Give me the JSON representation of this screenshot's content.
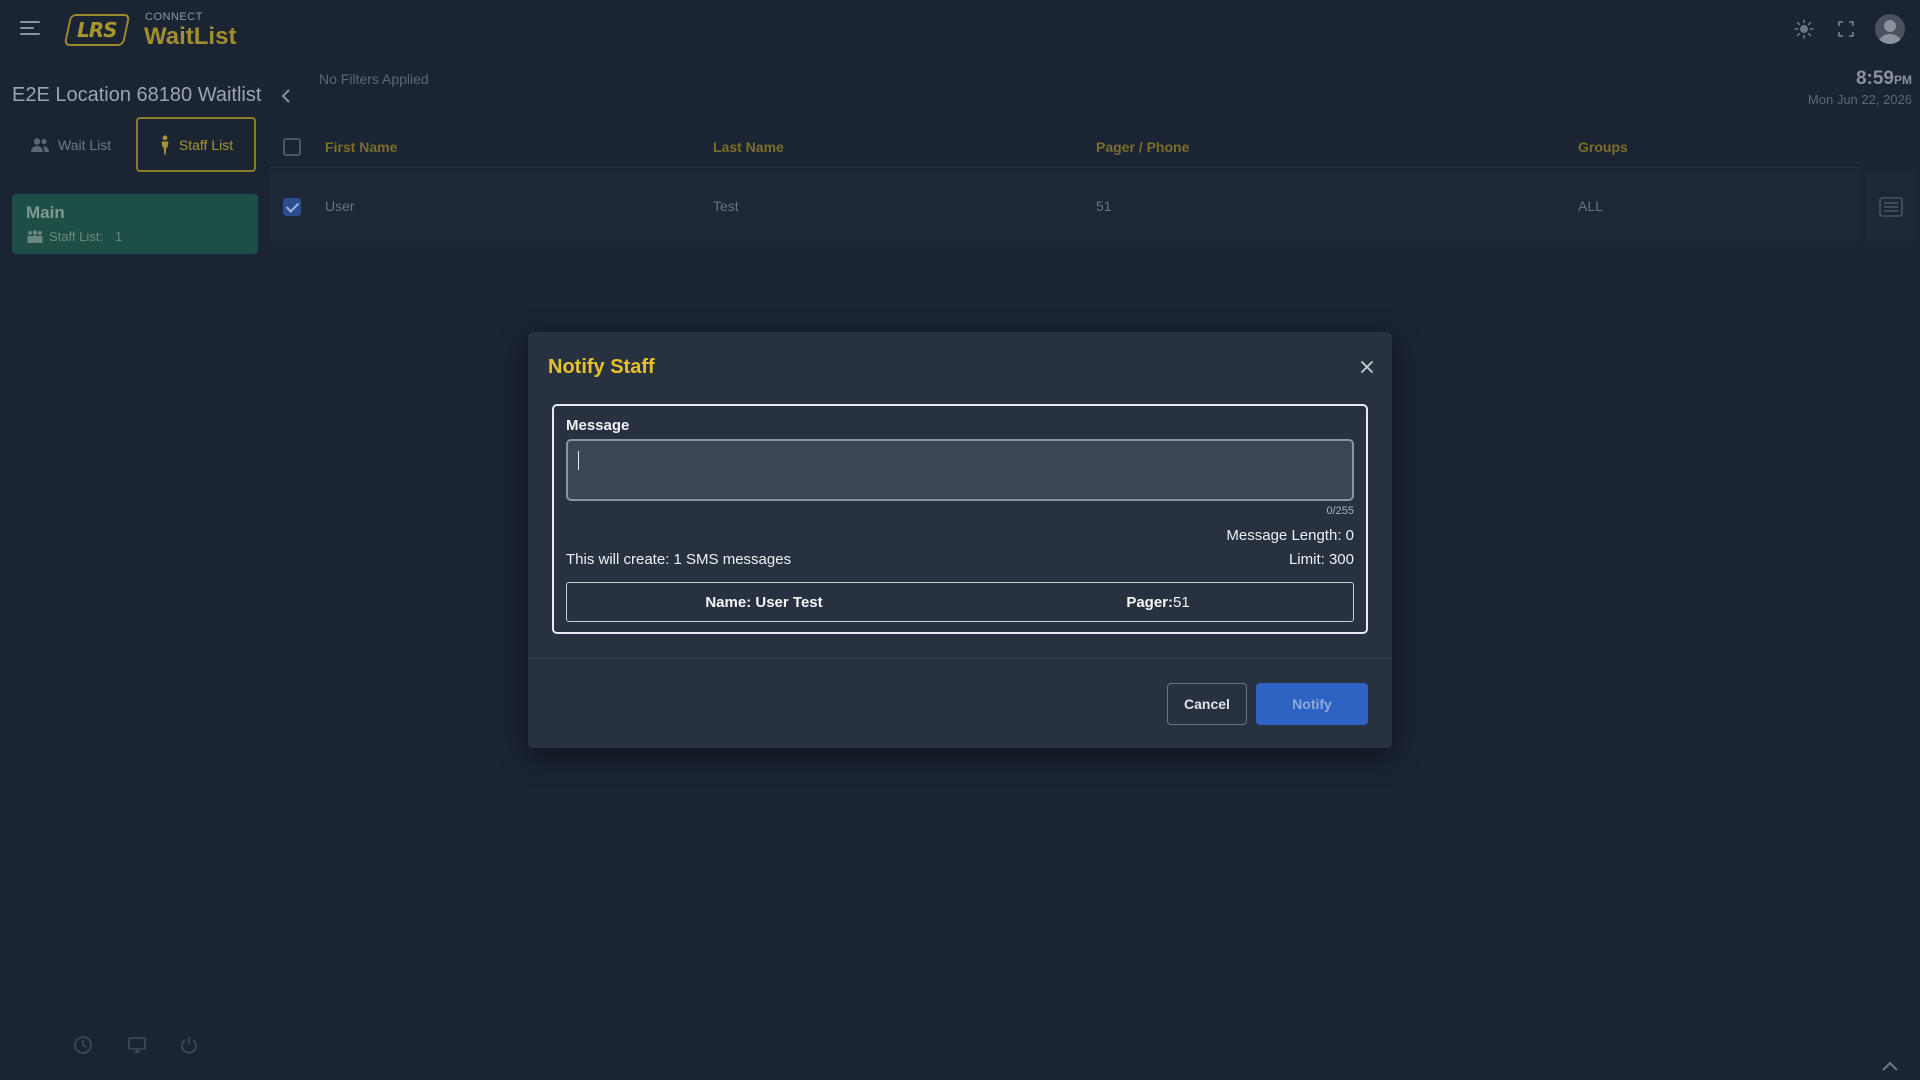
{
  "header": {
    "brand_small": "CONNECT",
    "brand_name": "WaitList",
    "logo_text": "LRS",
    "icons": [
      "menu-icon",
      "brightness-icon",
      "fullscreen-icon",
      "user-avatar-icon"
    ]
  },
  "sidebar": {
    "location_title": "E2E Location 68180 Waitlist",
    "tabs": [
      {
        "label": "Wait List",
        "icon": "people-icon",
        "active": false
      },
      {
        "label": "Staff List",
        "icon": "person-standing-icon",
        "active": true
      }
    ],
    "group": {
      "name": "Main",
      "count_label": "Staff List:",
      "count": "1",
      "icon": "group-icon"
    },
    "bottom_icons": [
      "history-icon",
      "monitor-icon",
      "power-icon"
    ]
  },
  "main": {
    "filters_text": "No Filters Applied",
    "clock": {
      "time": "8:59",
      "ampm": "PM",
      "date": "Mon Jun 22, 2026"
    },
    "table": {
      "columns": [
        "First Name",
        "Last Name",
        "Pager / Phone",
        "Groups"
      ],
      "rows": [
        {
          "first_name": "User",
          "last_name": "Test",
          "pager": "51",
          "groups": "ALL",
          "checked": true
        }
      ]
    }
  },
  "modal": {
    "title": "Notify Staff",
    "message_label": "Message",
    "message_value": "",
    "char_counter": "0/255",
    "message_length": "Message Length: 0",
    "sms_info": "This will create: 1 SMS messages",
    "limit": "Limit: 300",
    "recipient": {
      "name_label": "Name:",
      "name_value": "User Test",
      "pager_label": "Pager:",
      "pager_value": "51"
    },
    "cancel_label": "Cancel",
    "notify_label": "Notify"
  },
  "colors": {
    "background": "#1b2433",
    "accent_gold": "#e8c12a",
    "group_card": "#1d4f47",
    "notify_button": "#2e62c2",
    "modal_bg": "#27313f"
  }
}
